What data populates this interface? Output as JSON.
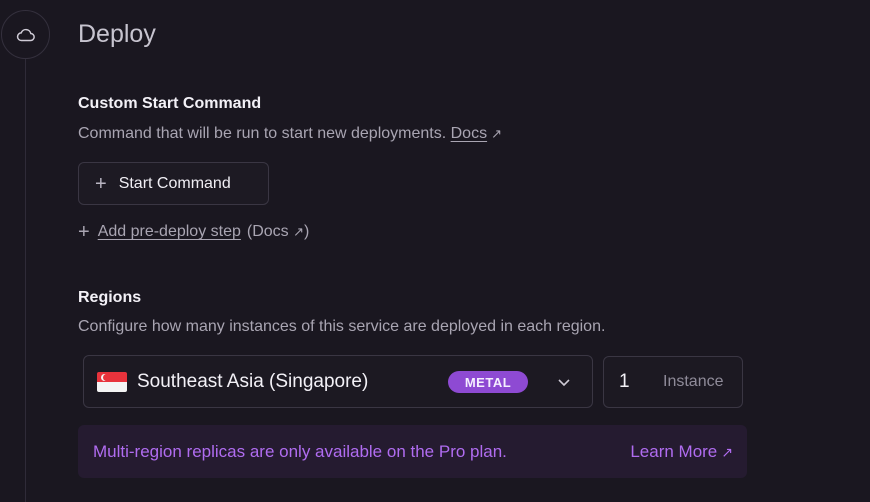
{
  "section": {
    "title": "Deploy",
    "icon": "cloud-icon"
  },
  "start_command": {
    "heading": "Custom Start Command",
    "description": "Command that will be run to start new deployments.",
    "docs_label": "Docs",
    "button_label": "Start Command",
    "predeploy_label": "Add pre-deploy step",
    "predeploy_docs": "(Docs",
    "predeploy_close": ")"
  },
  "regions": {
    "heading": "Regions",
    "description": "Configure how many instances of this service are deployed in each region.",
    "selected_region": "Southeast Asia (Singapore)",
    "badge": "METAL",
    "instance_count": "1",
    "instance_label": "Instance",
    "notice": "Multi-region replicas are only available on the Pro plan.",
    "learn_more": "Learn More"
  },
  "colors": {
    "accent": "#8e4ad3",
    "notice_text": "#b06cf0",
    "background": "#1a1720"
  }
}
